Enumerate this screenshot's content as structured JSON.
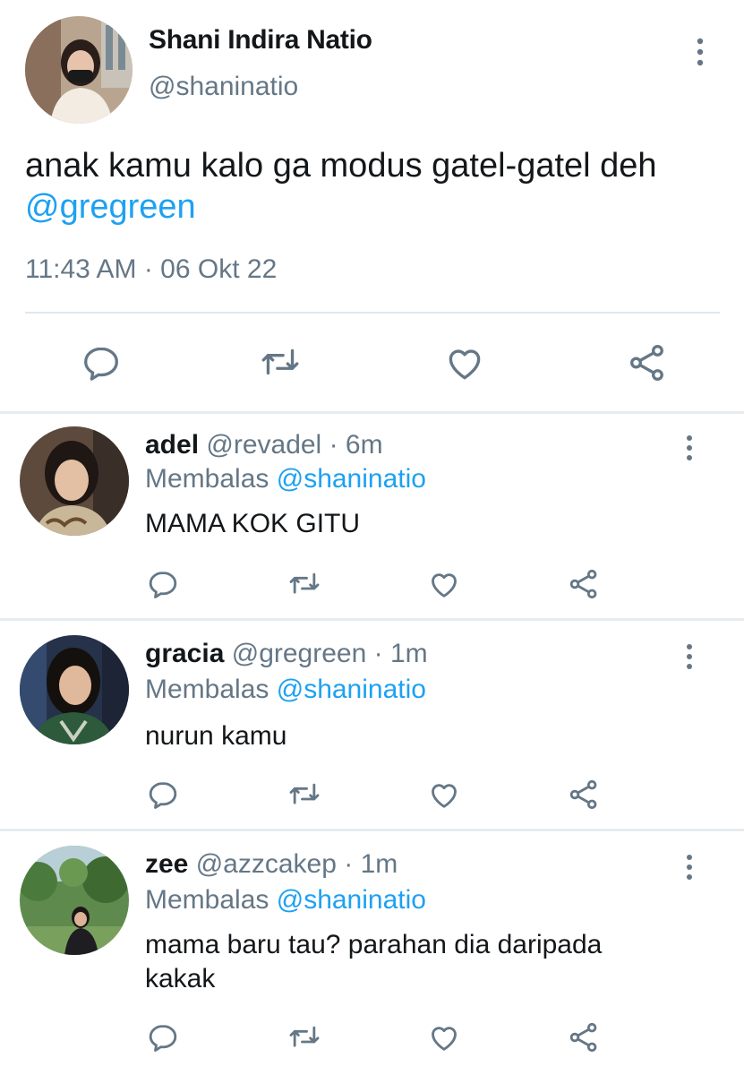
{
  "main_tweet": {
    "name": "Shani Indira Natio",
    "handle": "@shaninatio",
    "text": "anak kamu kalo ga modus gatel-gatel deh",
    "mention": "@gregreen",
    "timestamp": "11:43 AM · 06 Okt 22",
    "icons": [
      "avatar",
      "more-vertical-icon",
      "reply-icon",
      "retweet-icon",
      "like-icon",
      "share-icon"
    ]
  },
  "replies": [
    {
      "name": "adel",
      "handle": "@revadel",
      "separator": "·",
      "time": "6m",
      "replying_label": "Membalas",
      "replying_to": "@shaninatio",
      "text": "MAMA KOK GITU"
    },
    {
      "name": "gracia",
      "handle": "@gregreen",
      "separator": "·",
      "time": "1m",
      "replying_label": "Membalas",
      "replying_to": "@shaninatio",
      "text": "nurun kamu"
    },
    {
      "name": "zee",
      "handle": "@azzcakep",
      "separator": "·",
      "time": "1m",
      "replying_label": "Membalas",
      "replying_to": "@shaninatio",
      "text": "mama baru tau? parahan dia daripada kakak"
    }
  ],
  "colors": {
    "text": "#14171a",
    "secondary": "#657786",
    "link": "#1da1f2",
    "divider": "#e6ecf0"
  }
}
